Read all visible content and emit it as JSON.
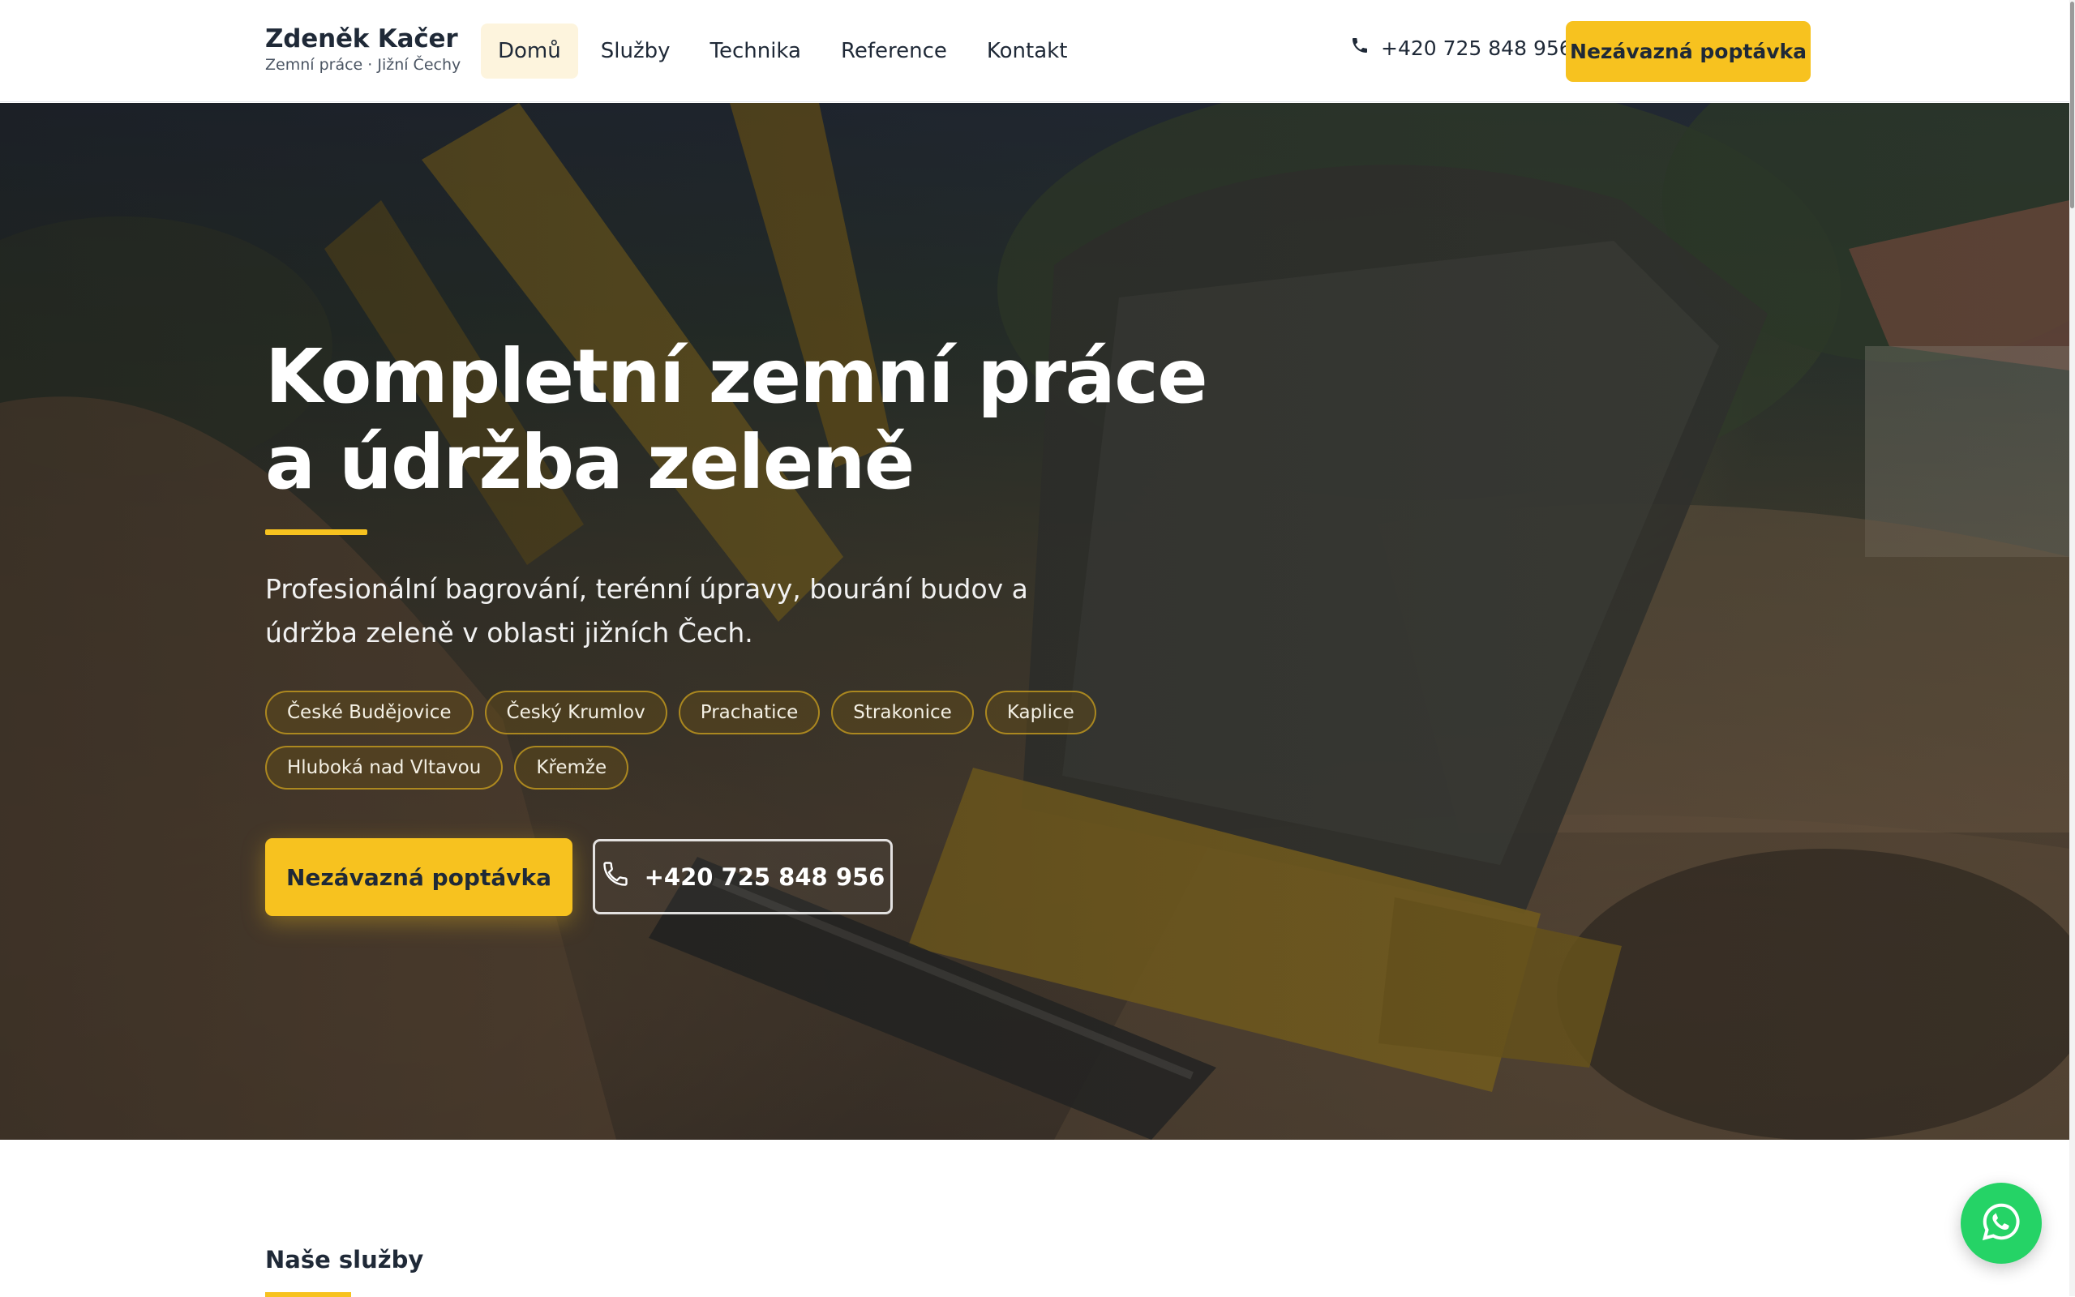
{
  "brand": {
    "name": "Zdeněk Kačer",
    "tagline": "Zemní práce · Jižní Čechy"
  },
  "nav": {
    "items": [
      {
        "label": "Domů",
        "active": true
      },
      {
        "label": "Služby",
        "active": false
      },
      {
        "label": "Technika",
        "active": false
      },
      {
        "label": "Reference",
        "active": false
      },
      {
        "label": "Kontakt",
        "active": false
      }
    ]
  },
  "header": {
    "phone": "+420 725 848 956",
    "phone_icon": "phone-icon",
    "cta_label": "Nezávazná poptávka"
  },
  "hero": {
    "title_line1": "Kompletní zemní práce",
    "title_line2": "a údržba zeleně",
    "lead": "Profesionální bagrování, terénní úpravy, bourání budov a údržba zeleně v oblasti jižních Čech.",
    "locations": [
      "České Budějovice",
      "Český Krumlov",
      "Prachatice",
      "Strakonice",
      "Kaplice",
      "Hluboká nad Vltavou",
      "Křemže"
    ],
    "primary_cta": "Nezávazná poptávka",
    "phone_cta": "+420 725 848 956",
    "background_image": "excavator-photo"
  },
  "services": {
    "heading": "Naše služby"
  },
  "whatsapp": {
    "icon": "whatsapp-icon"
  },
  "colors": {
    "accent": "#f7c21f",
    "text_dark": "#1f2937",
    "whatsapp": "#25d366"
  }
}
